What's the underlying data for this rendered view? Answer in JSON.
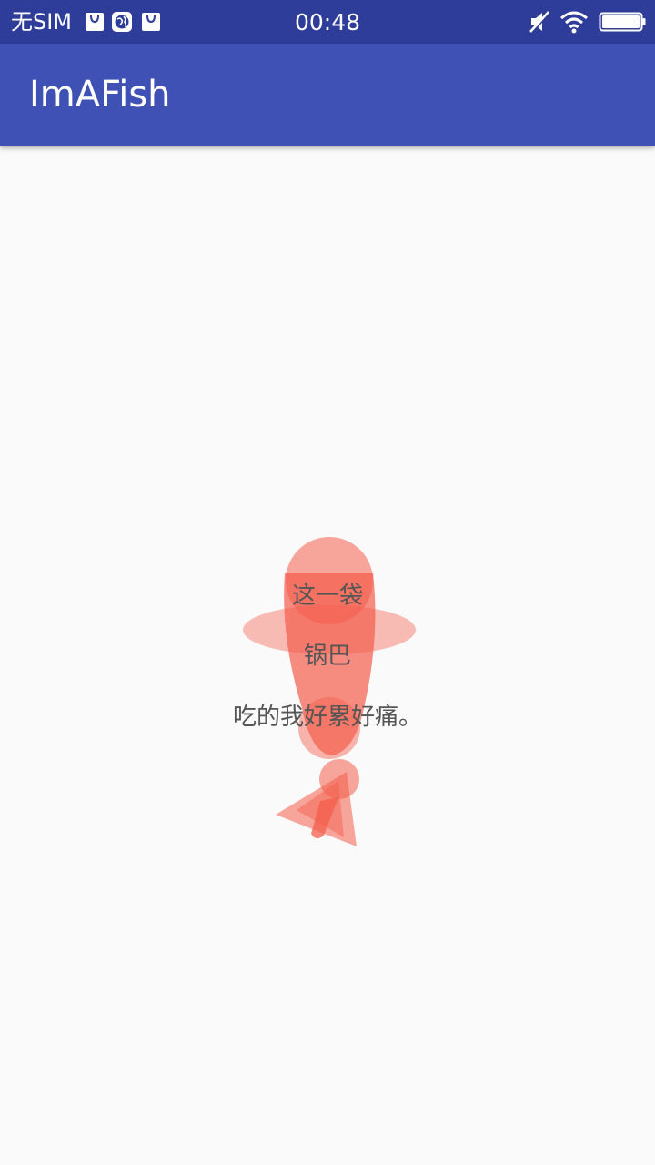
{
  "status_bar": {
    "carrier": "无SIM",
    "time": "00:48",
    "icons": [
      "bag-icon",
      "globe-icon",
      "bag-icon",
      "mute-icon",
      "wifi-icon",
      "battery-icon"
    ]
  },
  "app_bar": {
    "title": "ImAFish"
  },
  "fish": {
    "color": "#f45d4b",
    "line1": "这一袋",
    "line2": "锅巴",
    "line3": "吃的我好累好痛。"
  }
}
